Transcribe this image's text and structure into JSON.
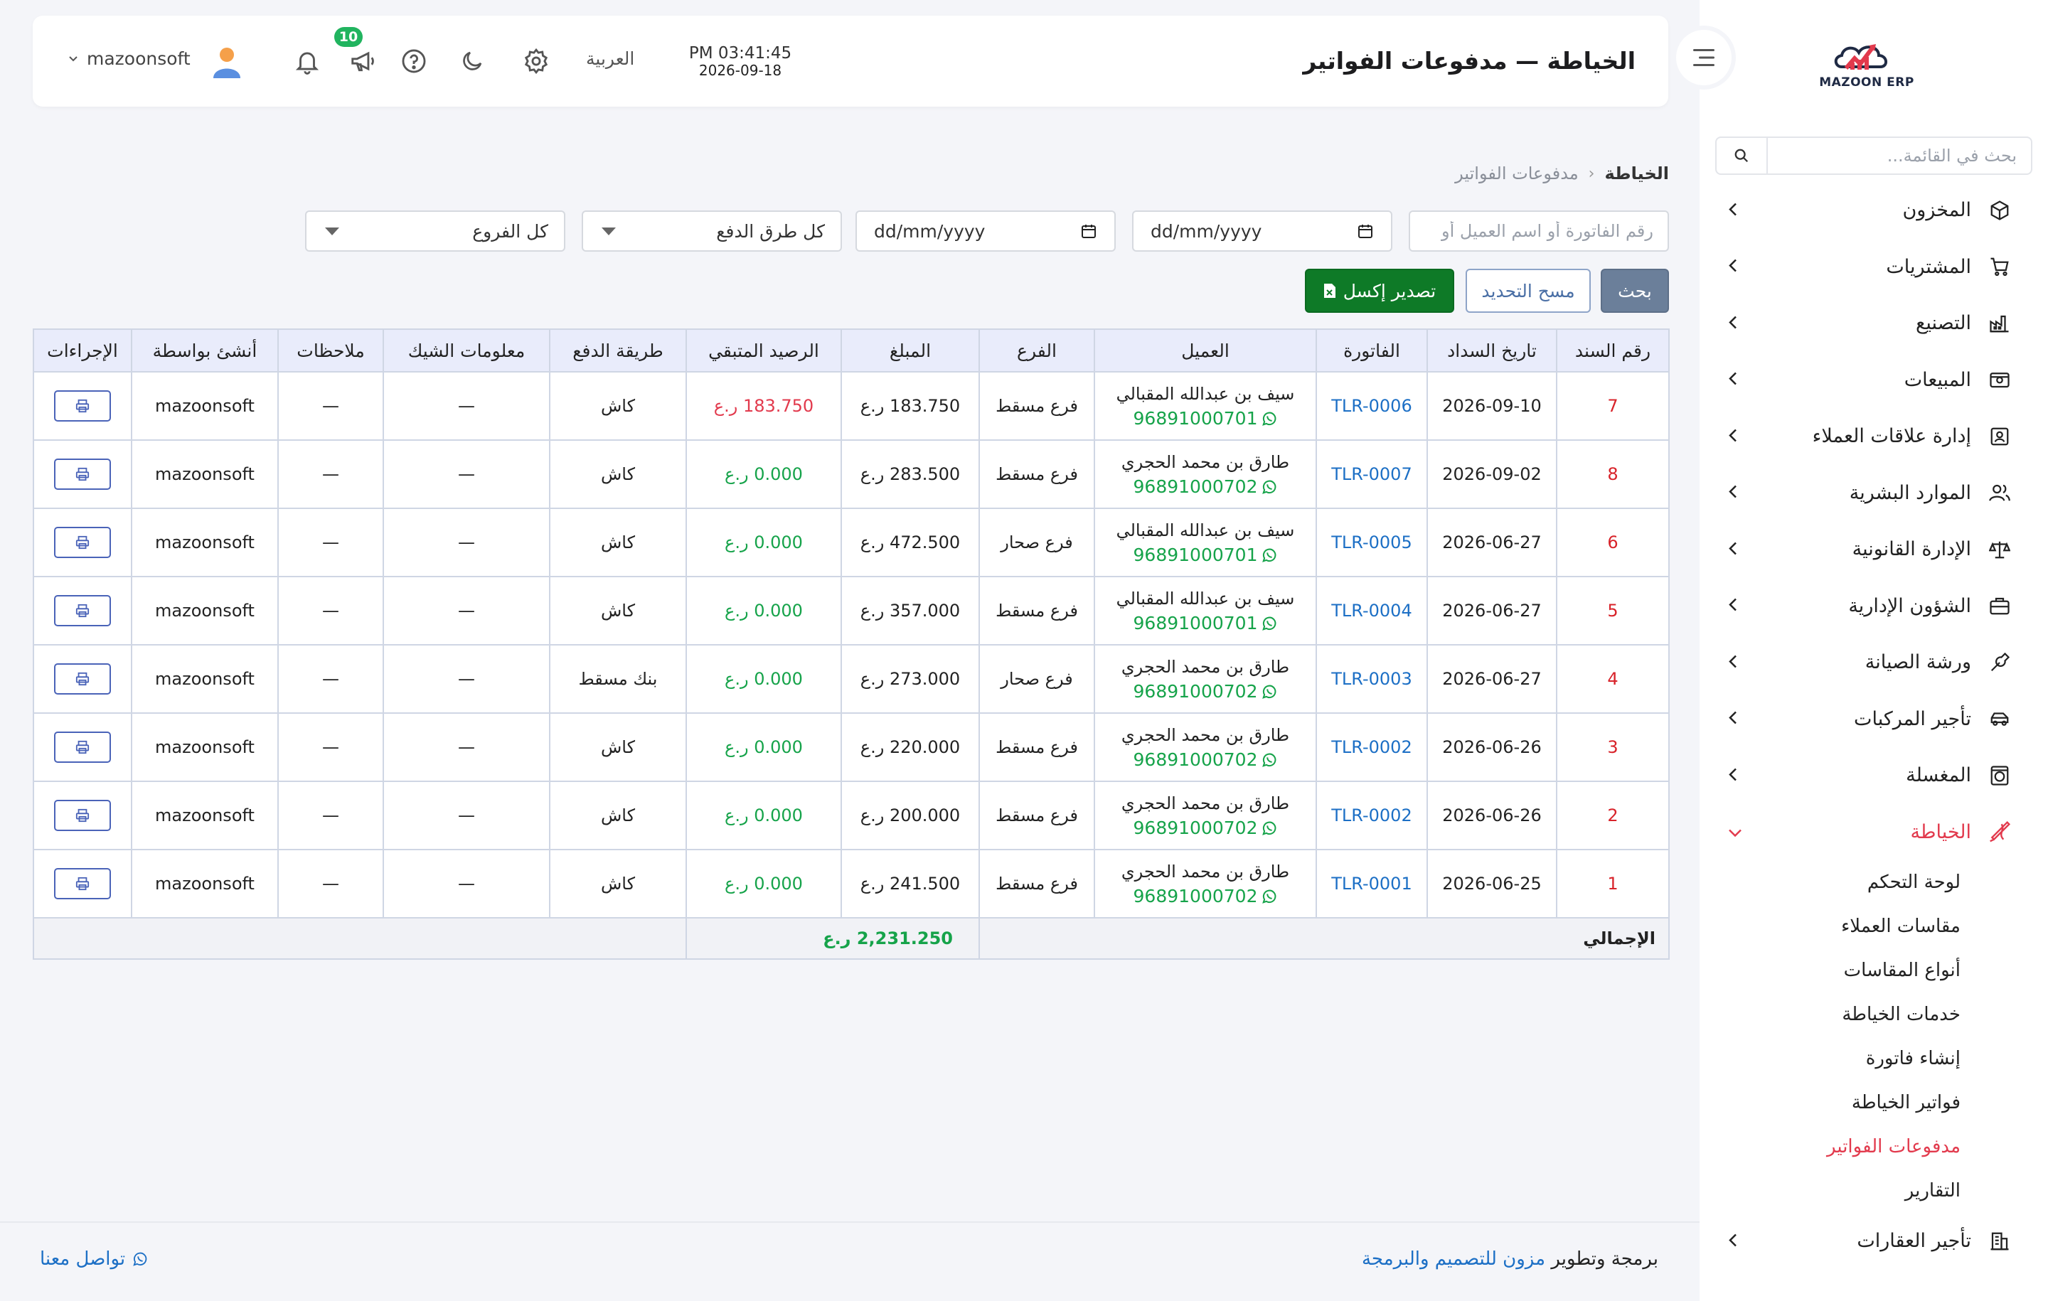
{
  "app": {
    "logo_text": "MAZOON ERP",
    "page_title": "الخياطة — مدفوعات الفواتير",
    "time": "PM 03:41:45",
    "date": "2026-09-18",
    "language": "العربية",
    "notification_count": "10",
    "username": "mazoonsoft"
  },
  "sidebar": {
    "search_placeholder": "بحث في القائمة...",
    "items": [
      {
        "label": "المخزون",
        "icon": "box-icon"
      },
      {
        "label": "المشتريات",
        "icon": "cart-icon"
      },
      {
        "label": "التصنيع",
        "icon": "factory-icon"
      },
      {
        "label": "المبيعات",
        "icon": "cash-register-icon"
      },
      {
        "label": "إدارة علاقات العملاء",
        "icon": "contact-card-icon"
      },
      {
        "label": "الموارد البشرية",
        "icon": "users-icon"
      },
      {
        "label": "الإدارة القانونية",
        "icon": "scales-icon"
      },
      {
        "label": "الشؤون الإدارية",
        "icon": "briefcase-icon"
      },
      {
        "label": "ورشة الصيانة",
        "icon": "wrench-icon"
      },
      {
        "label": "تأجير المركبات",
        "icon": "car-icon"
      },
      {
        "label": "المغسلة",
        "icon": "washer-icon"
      },
      {
        "label": "الخياطة",
        "icon": "needle-icon"
      }
    ],
    "sub_items": [
      "لوحة التحكم",
      "مقاسات العملاء",
      "أنواع المقاسات",
      "خدمات الخياطة",
      "إنشاء فاتورة",
      "فواتير الخياطة",
      "مدفوعات الفواتير",
      "التقارير"
    ],
    "last_item": {
      "label": "تأجير العقارات",
      "icon": "building-icon"
    }
  },
  "breadcrumb": {
    "root": "الخياطة",
    "current": "مدفوعات الفواتير"
  },
  "filters": {
    "search_placeholder": "رقم الفاتورة أو اسم العميل أو",
    "date_from_placeholder": "dd/mm/yyyy",
    "date_to_placeholder": "dd/mm/yyyy",
    "payment_method": "كل طرق الدفع",
    "branch": "كل الفروع",
    "search_btn": "بحث",
    "clear_btn": "مسح التحديد",
    "export_btn": "تصدير إكسل"
  },
  "table": {
    "columns": [
      "رقم السند",
      "تاريخ السداد",
      "الفاتورة",
      "العميل",
      "الفرع",
      "المبلغ",
      "الرصيد المتبقي",
      "طريقة الدفع",
      "معلومات الشيك",
      "ملاحظات",
      "أنشئ بواسطة",
      "الإجراءات"
    ],
    "rows": [
      {
        "id": "7",
        "date": "2026-09-10",
        "invoice": "TLR-0006",
        "customer": "سيف بن عبدالله المقبالي",
        "phone": "96891000701",
        "branch": "فرع مسقط",
        "amount": "183.750 ر.ع",
        "balance": "183.750 ر.ع",
        "balance_due": true,
        "method": "كاش",
        "cheque": "—",
        "notes": "—",
        "created_by": "mazoonsoft"
      },
      {
        "id": "8",
        "date": "2026-09-02",
        "invoice": "TLR-0007",
        "customer": "طارق بن محمد الحجري",
        "phone": "96891000702",
        "branch": "فرع مسقط",
        "amount": "283.500 ر.ع",
        "balance": "0.000 ر.ع",
        "balance_due": false,
        "method": "كاش",
        "cheque": "—",
        "notes": "—",
        "created_by": "mazoonsoft"
      },
      {
        "id": "6",
        "date": "2026-06-27",
        "invoice": "TLR-0005",
        "customer": "سيف بن عبدالله المقبالي",
        "phone": "96891000701",
        "branch": "فرع صحار",
        "amount": "472.500 ر.ع",
        "balance": "0.000 ر.ع",
        "balance_due": false,
        "method": "كاش",
        "cheque": "—",
        "notes": "—",
        "created_by": "mazoonsoft"
      },
      {
        "id": "5",
        "date": "2026-06-27",
        "invoice": "TLR-0004",
        "customer": "سيف بن عبدالله المقبالي",
        "phone": "96891000701",
        "branch": "فرع مسقط",
        "amount": "357.000 ر.ع",
        "balance": "0.000 ر.ع",
        "balance_due": false,
        "method": "كاش",
        "cheque": "—",
        "notes": "—",
        "created_by": "mazoonsoft"
      },
      {
        "id": "4",
        "date": "2026-06-27",
        "invoice": "TLR-0003",
        "customer": "طارق بن محمد الحجري",
        "phone": "96891000702",
        "branch": "فرع صحار",
        "amount": "273.000 ر.ع",
        "balance": "0.000 ر.ع",
        "balance_due": false,
        "method": "بنك مسقط",
        "cheque": "—",
        "notes": "—",
        "created_by": "mazoonsoft"
      },
      {
        "id": "3",
        "date": "2026-06-26",
        "invoice": "TLR-0002",
        "customer": "طارق بن محمد الحجري",
        "phone": "96891000702",
        "branch": "فرع مسقط",
        "amount": "220.000 ر.ع",
        "balance": "0.000 ر.ع",
        "balance_due": false,
        "method": "كاش",
        "cheque": "—",
        "notes": "—",
        "created_by": "mazoonsoft"
      },
      {
        "id": "2",
        "date": "2026-06-26",
        "invoice": "TLR-0002",
        "customer": "طارق بن محمد الحجري",
        "phone": "96891000702",
        "branch": "فرع مسقط",
        "amount": "200.000 ر.ع",
        "balance": "0.000 ر.ع",
        "balance_due": false,
        "method": "كاش",
        "cheque": "—",
        "notes": "—",
        "created_by": "mazoonsoft"
      },
      {
        "id": "1",
        "date": "2026-06-25",
        "invoice": "TLR-0001",
        "customer": "طارق بن محمد الحجري",
        "phone": "96891000702",
        "branch": "فرع مسقط",
        "amount": "241.500 ر.ع",
        "balance": "0.000 ر.ع",
        "balance_due": false,
        "method": "كاش",
        "cheque": "—",
        "notes": "—",
        "created_by": "mazoonsoft"
      }
    ],
    "total_label": "الإجمالي",
    "total_value": "2,231.250 ر.ع"
  },
  "footer": {
    "credit_prefix": "برمجة وتطوير",
    "credit_brand": "مزون للتصميم والبرمجة",
    "contact": "تواصل معنا"
  },
  "colors": {
    "accent_red": "#e23a4d",
    "link_blue": "#1c6fc5",
    "success_green": "#16a34a",
    "excel_green": "#0e7a27",
    "header_bg": "#e9ecfb"
  }
}
